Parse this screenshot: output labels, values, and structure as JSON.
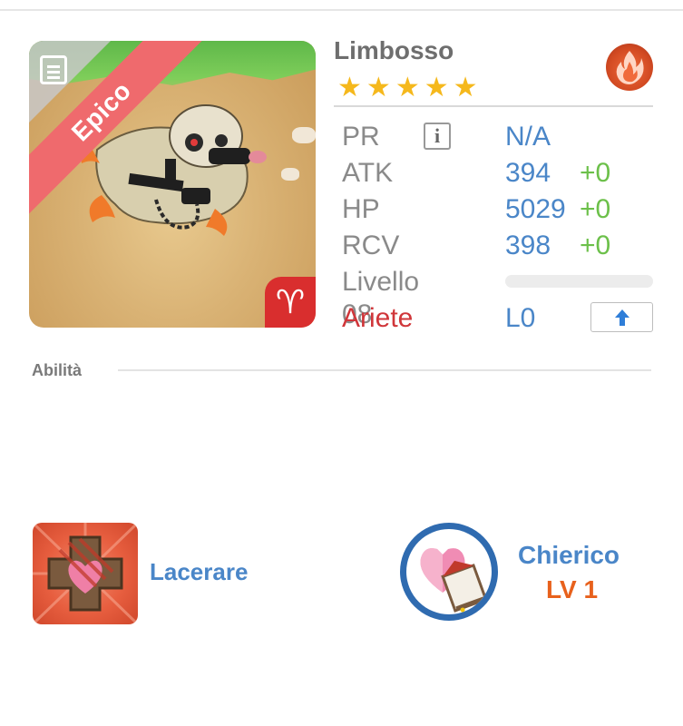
{
  "monster": {
    "name": "Limbosso",
    "rarity_label": "Epico",
    "stars": 5,
    "element_icon": "fire-icon",
    "zodiac_icon": "aries-icon"
  },
  "stats": {
    "pr": {
      "label": "PR",
      "value": "N/A"
    },
    "atk": {
      "label": "ATK",
      "value": "394",
      "bonus": "+0"
    },
    "hp": {
      "label": "HP",
      "value": "5029",
      "bonus": "+0"
    },
    "rcv": {
      "label": "RCV",
      "value": "398",
      "bonus": "+0"
    },
    "level": {
      "label": "Livello 08",
      "xp_progress": 0.0
    },
    "zodiac": {
      "label": "Ariete",
      "value": "L0"
    }
  },
  "abilities": {
    "section_title": "Abilità",
    "skill": {
      "name": "Lacerare",
      "icon": "heart-cross-icon"
    },
    "class": {
      "name": "Chierico",
      "level": "LV 1",
      "icon": "cleric-heart-icon"
    }
  },
  "colors": {
    "value_blue": "#4a86c8",
    "bonus_green": "#6cc04a",
    "zodiac_red": "#d0363a",
    "star_gold": "#f5b81c",
    "ribbon_red": "#ef6a6d",
    "level_orange": "#e8611c"
  }
}
